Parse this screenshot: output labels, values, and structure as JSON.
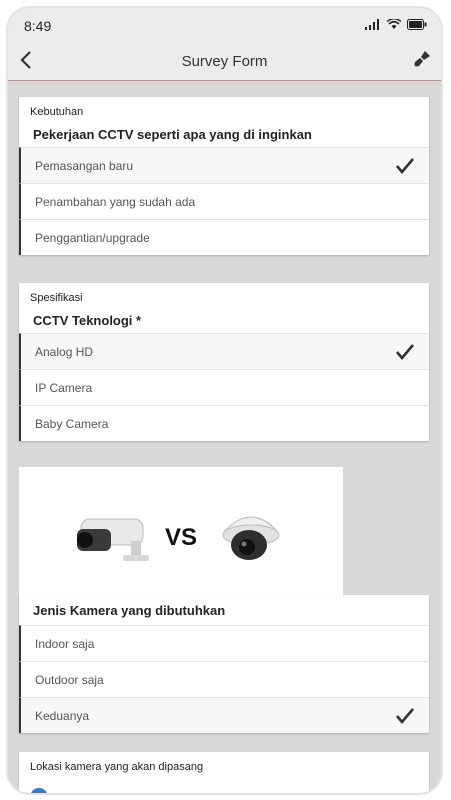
{
  "status_bar": {
    "time": "8:49"
  },
  "header": {
    "title": "Survey Form"
  },
  "sections": [
    {
      "label": "Kebutuhan",
      "question": "Pekerjaan CCTV seperti apa yang di inginkan",
      "options": [
        {
          "label": "Pemasangan baru",
          "selected": true
        },
        {
          "label": "Penambahan yang sudah ada",
          "selected": false
        },
        {
          "label": "Penggantian/upgrade",
          "selected": false
        }
      ]
    },
    {
      "label": "Spesifikasi",
      "question": "CCTV Teknologi *",
      "options": [
        {
          "label": "Analog HD",
          "selected": true
        },
        {
          "label": "IP Camera",
          "selected": false
        },
        {
          "label": "Baby Camera",
          "selected": false
        }
      ]
    }
  ],
  "camera_image": {
    "vs_text": "VS"
  },
  "camera_type": {
    "question": "Jenis Kamera yang dibutuhkan",
    "options": [
      {
        "label": "Indoor saja",
        "selected": false
      },
      {
        "label": "Outdoor saja",
        "selected": false
      },
      {
        "label": "Keduanya",
        "selected": true
      }
    ]
  },
  "location": {
    "label": "Lokasi kamera yang akan dipasang"
  },
  "colors": {
    "accent_line": "#c98a8a",
    "check": "#333333"
  }
}
